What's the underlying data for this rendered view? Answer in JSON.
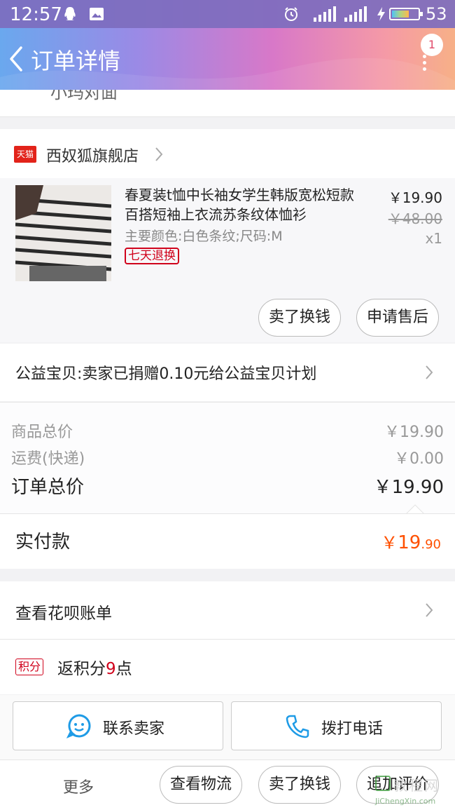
{
  "status_bar": {
    "time": "12:57",
    "battery_percent": "53"
  },
  "header": {
    "title": "订单详情",
    "notification_count": "1"
  },
  "address": {
    "partial_text": "小玛对面"
  },
  "shop": {
    "icon_text": "天猫",
    "name": "西奴狐旗舰店"
  },
  "product": {
    "title": "春夏装t恤中长袖女学生韩版宽松短款百搭短袖上衣流苏条纹体恤衫",
    "sku": "主要颜色:白色条纹;尺码:M",
    "tag": "七天退换",
    "price": "￥19.90",
    "original_price": "￥48.00",
    "quantity": "x1",
    "actions": [
      "卖了换钱",
      "申请售后"
    ]
  },
  "charity": {
    "text": "公益宝贝:卖家已捐赠0.10元给公益宝贝计划"
  },
  "summary": {
    "goods_total_label": "商品总价",
    "goods_total_value": "￥19.90",
    "shipping_label": "运费(快递)",
    "shipping_value": "￥0.00",
    "order_total_label": "订单总价",
    "order_total_value": "￥19.90",
    "paid_label": "实付款",
    "paid_currency": "￥",
    "paid_int": "19",
    "paid_dec": ".90"
  },
  "huabei": {
    "label": "查看花呗账单"
  },
  "points": {
    "badge": "积分",
    "prefix": "返积分",
    "value": "9",
    "suffix": "点"
  },
  "contact": {
    "seller_label": "联系卖家",
    "phone_label": "拨打电话"
  },
  "bottom_bar": {
    "more_label": "更多",
    "buttons": [
      "查看物流",
      "卖了换钱",
      "追加评价"
    ],
    "watermark_text": "教程网",
    "watermark_url": "JiChengXin.com"
  },
  "colors": {
    "accent": "#ff5000",
    "tmall_red": "#e2231a",
    "tag_red": "#d0021b"
  }
}
